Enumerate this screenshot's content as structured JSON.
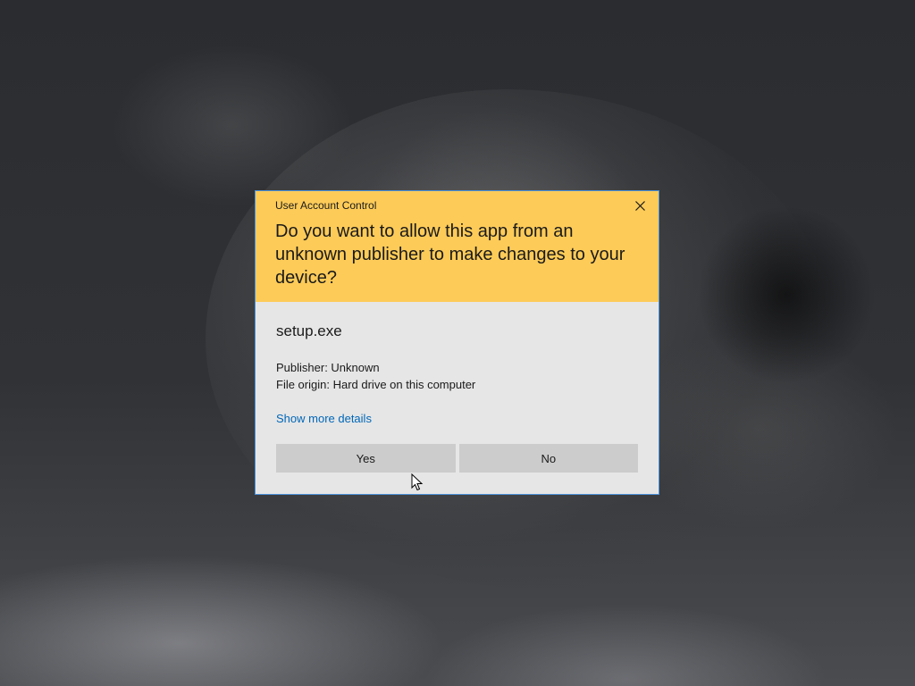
{
  "dialog": {
    "title": "User Account Control",
    "question": "Do you want to allow this app from an unknown publisher to make changes to your device?",
    "app_name": "setup.exe",
    "publisher_line": "Publisher: Unknown",
    "origin_line": "File origin: Hard drive on this computer",
    "details_link": "Show more details",
    "yes_label": "Yes",
    "no_label": "No",
    "close_icon": "close-icon"
  },
  "colors": {
    "header_bg": "#fdcb58",
    "body_bg": "#e6e6e6",
    "button_bg": "#cccccc",
    "link": "#0067b8",
    "border": "#4a90d9"
  },
  "background": {
    "description_icon": "skull-wallpaper"
  }
}
